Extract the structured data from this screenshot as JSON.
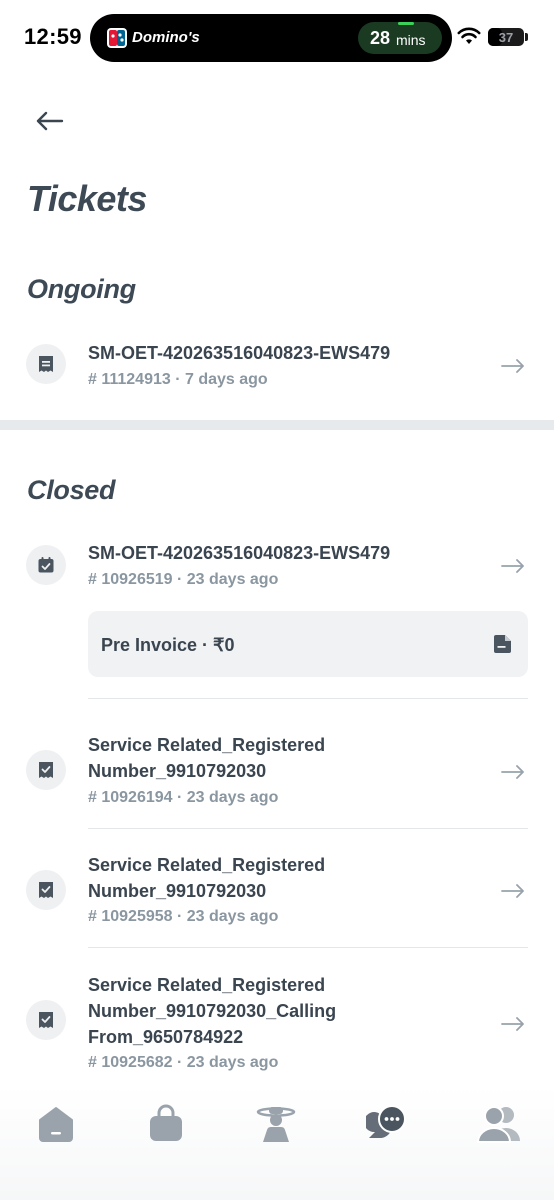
{
  "status_bar": {
    "time": "12:59",
    "live_activity": {
      "brand": "Domino's",
      "eta_value": "28",
      "eta_unit": "mins"
    },
    "battery": "37"
  },
  "header": {
    "title": "Tickets"
  },
  "sections": {
    "ongoing": {
      "title": "Ongoing",
      "tickets": [
        {
          "title": "SM-OET-420263516040823-EWS479",
          "meta": "# 11124913 · 7 days ago",
          "icon": "receipt-icon"
        }
      ]
    },
    "closed": {
      "title": "Closed",
      "tickets": [
        {
          "title": "SM-OET-420263516040823-EWS479",
          "meta": "# 10926519 · 23 days ago",
          "icon": "calendar-check-icon",
          "attachment": {
            "label": "Pre Invoice · ₹0",
            "icon": "document-icon"
          }
        },
        {
          "title": "Service Related_Registered Number_9910792030",
          "meta": "# 10926194 · 23 days ago",
          "icon": "receipt-check-icon"
        },
        {
          "title": "Service Related_Registered Number_9910792030",
          "meta": "# 10925958 · 23 days ago",
          "icon": "receipt-check-icon"
        },
        {
          "title": "Service Related_Registered Number_9910792030_Calling From_9650784922",
          "meta": "# 10925682 · 23 days ago",
          "icon": "receipt-check-icon"
        }
      ]
    }
  },
  "bottom_nav": {
    "items": [
      {
        "name": "home",
        "icon": "home-icon",
        "active": false
      },
      {
        "name": "orders",
        "icon": "bag-icon",
        "active": false
      },
      {
        "name": "technician",
        "icon": "technician-icon",
        "active": false
      },
      {
        "name": "support",
        "icon": "chat-icon",
        "active": true
      },
      {
        "name": "account",
        "icon": "users-icon",
        "active": false
      }
    ]
  },
  "colors": {
    "text_primary": "#3a4550",
    "text_secondary": "#8a96a0",
    "icon_inactive": "#9aa3ab",
    "icon_active": "#4a5560",
    "divider": "#e6eaed"
  }
}
